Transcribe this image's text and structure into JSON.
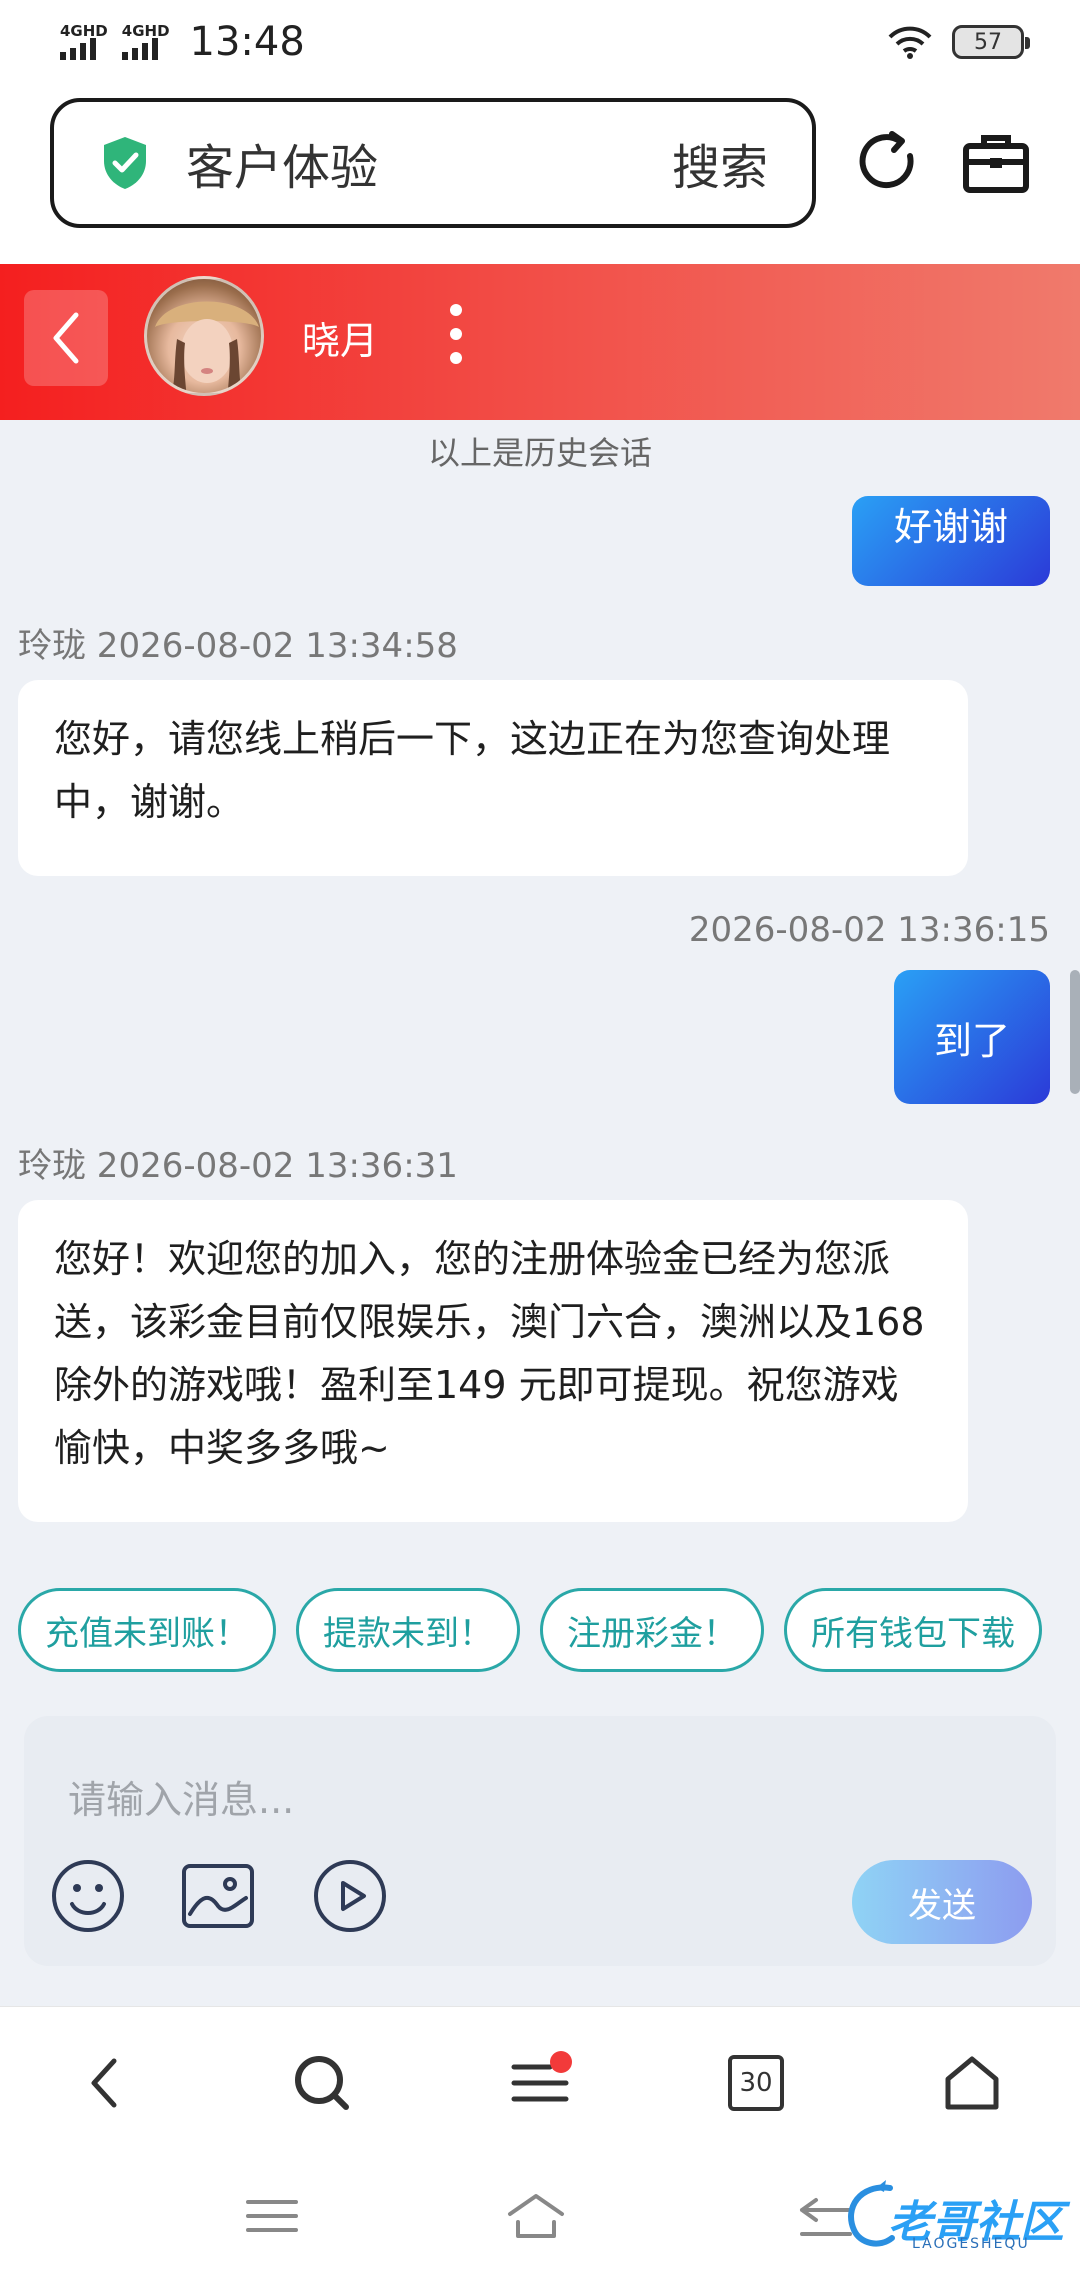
{
  "status_bar": {
    "signal_1": "4GHD",
    "signal_2": "4GHD",
    "time": "13:48",
    "battery": "57"
  },
  "browser": {
    "url_text": "客户体验",
    "search_label": "搜索"
  },
  "chat_header": {
    "name": "晓月"
  },
  "chat": {
    "history_note": "以上是历史会话",
    "messages": [
      {
        "direction": "out",
        "text": "好谢谢"
      },
      {
        "direction": "in",
        "meta": "玲珑 2026-08-02 13:34:58",
        "text": "您好，请您线上稍后一下，这边正在为您查询处理中，谢谢。"
      },
      {
        "direction": "out",
        "meta": "2026-08-02 13:36:15",
        "text": "到了"
      },
      {
        "direction": "in",
        "meta": "玲珑 2026-08-02 13:36:31",
        "text": "您好！欢迎您的加入，您的注册体验金已经为您派送，该彩金目前仅限娱乐，澳门六合，澳洲以及168除外的游戏哦！盈利至149 元即可提现。祝您游戏愉快，中奖多多哦~"
      }
    ]
  },
  "quick_replies": [
    "充值未到账！",
    "提款未到！",
    "注册彩金！",
    "所有钱包下载"
  ],
  "composer": {
    "placeholder": "请输入消息...",
    "send_label": "发送"
  },
  "browser_nav": {
    "tabs_count": "30"
  },
  "watermark": {
    "text": "老哥社区",
    "sub": "LAOGESHEQU"
  },
  "colors": {
    "header_start": "#f41f1f",
    "header_end": "#f07a6c",
    "bubble_out_start": "#2aa0f5",
    "bubble_out_end": "#2b3ad8",
    "chip_border": "#2aa8a8",
    "shield": "#2fb57a"
  }
}
